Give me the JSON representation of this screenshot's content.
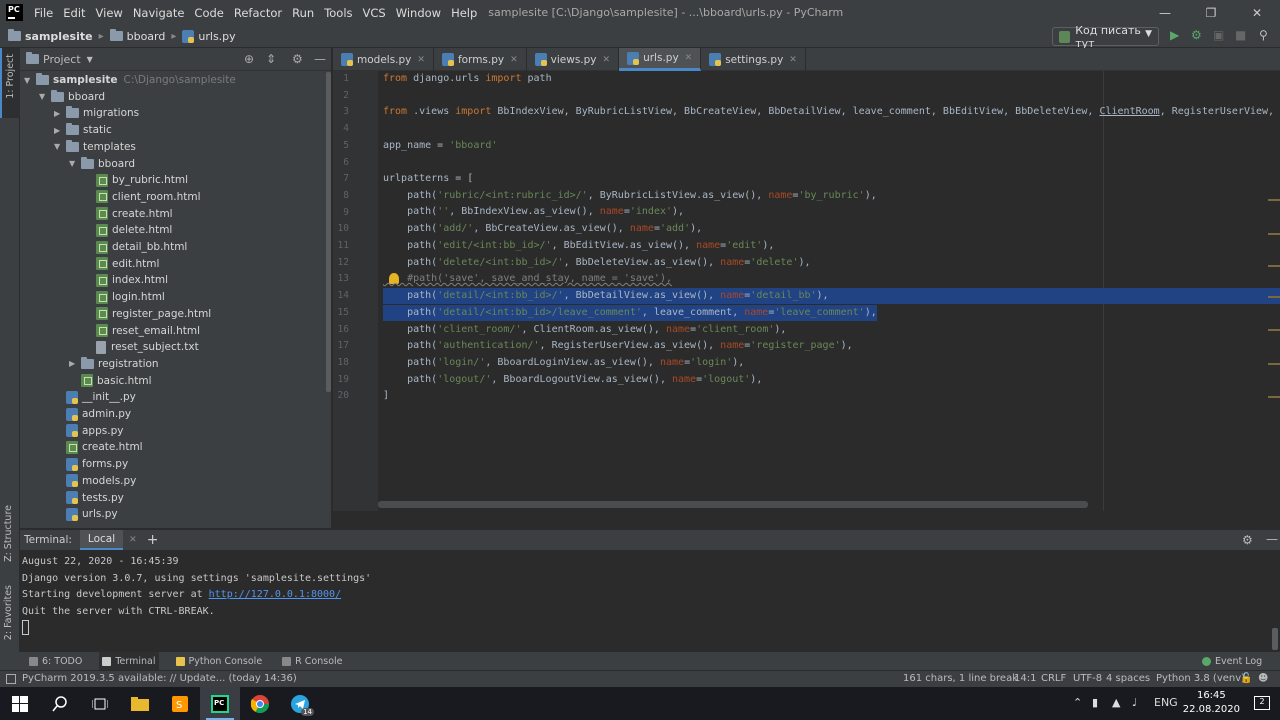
{
  "menubar": {
    "items": [
      "File",
      "Edit",
      "View",
      "Navigate",
      "Code",
      "Refactor",
      "Run",
      "Tools",
      "VCS",
      "Window",
      "Help"
    ],
    "title": "samplesite [C:\\Django\\samplesite] - ...\\bboard\\urls.py - PyCharm"
  },
  "navbar": {
    "crumbs": [
      "samplesite",
      "bboard",
      "urls.py"
    ],
    "run_config": "Код писать тут"
  },
  "project_panel": {
    "title": "Project",
    "tree": [
      {
        "label": "samplesite",
        "suffix": "C:\\Django\\samplesite",
        "depth": 0,
        "kind": "folder",
        "expanded": true,
        "bold": true
      },
      {
        "label": "bboard",
        "depth": 1,
        "kind": "folder",
        "expanded": true
      },
      {
        "label": "migrations",
        "depth": 2,
        "kind": "folder",
        "expanded": false
      },
      {
        "label": "static",
        "depth": 2,
        "kind": "folder",
        "expanded": false
      },
      {
        "label": "templates",
        "depth": 2,
        "kind": "folder",
        "expanded": true
      },
      {
        "label": "bboard",
        "depth": 3,
        "kind": "folder",
        "expanded": true
      },
      {
        "label": "by_rubric.html",
        "depth": 4,
        "kind": "html"
      },
      {
        "label": "client_room.html",
        "depth": 4,
        "kind": "html"
      },
      {
        "label": "create.html",
        "depth": 4,
        "kind": "html"
      },
      {
        "label": "delete.html",
        "depth": 4,
        "kind": "html"
      },
      {
        "label": "detail_bb.html",
        "depth": 4,
        "kind": "html"
      },
      {
        "label": "edit.html",
        "depth": 4,
        "kind": "html"
      },
      {
        "label": "index.html",
        "depth": 4,
        "kind": "html"
      },
      {
        "label": "login.html",
        "depth": 4,
        "kind": "html"
      },
      {
        "label": "register_page.html",
        "depth": 4,
        "kind": "html"
      },
      {
        "label": "reset_email.html",
        "depth": 4,
        "kind": "html"
      },
      {
        "label": "reset_subject.txt",
        "depth": 4,
        "kind": "txt"
      },
      {
        "label": "registration",
        "depth": 3,
        "kind": "folder",
        "expanded": false
      },
      {
        "label": "basic.html",
        "depth": 3,
        "kind": "html"
      },
      {
        "label": "__init__.py",
        "depth": 2,
        "kind": "py"
      },
      {
        "label": "admin.py",
        "depth": 2,
        "kind": "py"
      },
      {
        "label": "apps.py",
        "depth": 2,
        "kind": "py"
      },
      {
        "label": "create.html",
        "depth": 2,
        "kind": "html"
      },
      {
        "label": "forms.py",
        "depth": 2,
        "kind": "py"
      },
      {
        "label": "models.py",
        "depth": 2,
        "kind": "py"
      },
      {
        "label": "tests.py",
        "depth": 2,
        "kind": "py"
      },
      {
        "label": "urls.py",
        "depth": 2,
        "kind": "py"
      }
    ]
  },
  "editor_tabs": [
    {
      "label": "models.py",
      "active": false
    },
    {
      "label": "forms.py",
      "active": false
    },
    {
      "label": "views.py",
      "active": false
    },
    {
      "label": "urls.py",
      "active": true
    },
    {
      "label": "settings.py",
      "active": false
    }
  ],
  "code_lines": [
    "1",
    "2",
    "3",
    "4",
    "5",
    "6",
    "7",
    "8",
    "9",
    "10",
    "11",
    "12",
    "13",
    "14",
    "15",
    "16",
    "17",
    "18",
    "19",
    "20"
  ],
  "code": {
    "l1_a": "from",
    "l1_b": " django.urls ",
    "l1_c": "import",
    "l1_d": " path",
    "l3_a": "from",
    "l3_b": " .views ",
    "l3_c": "import",
    "l3_d": " BbIndexView, ByRubricListView, BbCreateView, BbDetailView, leave_comment, BbEditView, BbDeleteView, ",
    "l3_e": "ClientRoom",
    "l3_f": ", RegisterUserView, B",
    "l5_a": "app_name = ",
    "l5_b": "'bboard'",
    "l7": "urlpatterns = [",
    "l8_a": "    path(",
    "l8_b": "'rubric/<int:rubric_id>/'",
    "l8_c": ", ByRubricListView.as_view(), ",
    "l8_d": "name",
    "l8_e": "=",
    "l8_f": "'by_rubric'",
    "l8_g": "),",
    "l9_a": "    path(",
    "l9_b": "''",
    "l9_c": ", BbIndexView.as_view(), ",
    "l9_d": "name",
    "l9_e": "=",
    "l9_f": "'index'",
    "l9_g": "),",
    "l10_a": "    path(",
    "l10_b": "'add/'",
    "l10_c": ", BbCreateView.as_view(), ",
    "l10_d": "name",
    "l10_e": "=",
    "l10_f": "'add'",
    "l10_g": "),",
    "l11_a": "    path(",
    "l11_b": "'edit/<int:bb_id>/'",
    "l11_c": ", BbEditView.as_view(), ",
    "l11_d": "name",
    "l11_e": "=",
    "l11_f": "'edit'",
    "l11_g": "),",
    "l12_a": "    path(",
    "l12_b": "'delete/<int:bb_id>/'",
    "l12_c": ", BbDeleteView.as_view(), ",
    "l12_d": "name",
    "l12_e": "=",
    "l12_f": "'delete'",
    "l12_g": "),",
    "l13": "    #path('save', save_and_stay, name = 'save'),",
    "l14_a": "    path(",
    "l14_b": "'detail/<int:bb_id>/'",
    "l14_c": ", BbDetailView.as_view(), ",
    "l14_d": "name",
    "l14_e": "=",
    "l14_f": "'detail_bb'",
    "l14_g": "),",
    "l15_a": "    path(",
    "l15_b": "'detail/<int:bb_id>/leave_comment'",
    "l15_c": ", leave_comment, ",
    "l15_d": "name",
    "l15_e": "=",
    "l15_f": "'leave_comment'",
    "l15_g": "),",
    "l16_a": "    path(",
    "l16_b": "'client_room/'",
    "l16_c": ", ClientRoom.as_view(), ",
    "l16_d": "name",
    "l16_e": "=",
    "l16_f": "'client_room'",
    "l16_g": "),",
    "l17_a": "    path(",
    "l17_b": "'authentication/'",
    "l17_c": ", RegisterUserView.as_view(), ",
    "l17_d": "name",
    "l17_e": "=",
    "l17_f": "'register_page'",
    "l17_g": "),",
    "l18_a": "    path(",
    "l18_b": "'login/'",
    "l18_c": ", BboardLoginView.as_view(), ",
    "l18_d": "name",
    "l18_e": "=",
    "l18_f": "'login'",
    "l18_g": "),",
    "l19_a": "    path(",
    "l19_b": "'logout/'",
    "l19_c": ", BboardLogoutView.as_view(), ",
    "l19_d": "name",
    "l19_e": "=",
    "l19_f": "'logout'",
    "l19_g": "),",
    "l20": "]"
  },
  "terminal": {
    "label": "Terminal:",
    "tab": "Local",
    "plus": "+",
    "lines": [
      "August 22, 2020 - 16:45:39",
      "Django version 3.0.7, using settings 'samplesite.settings'",
      "Starting development server at "
    ],
    "link": "http://127.0.0.1:8000/",
    "last": "Quit the server with CTRL-BREAK."
  },
  "left_strip": {
    "project": "1: Project",
    "structure": "Z: Structure",
    "favorites": "2: Favorites"
  },
  "bottom_tools": [
    "6: TODO",
    "Terminal",
    "Python Console",
    "R Console"
  ],
  "event_log": "Event Log",
  "status": {
    "message": "PyCharm 2019.3.5 available: // Update... (today 14:36)",
    "chars": "161 chars, 1 line break",
    "pos": "14:1",
    "eol": "CRLF",
    "enc": "UTF-8",
    "indent": "4 spaces",
    "interp": "Python 3.8 (venv)"
  },
  "taskbar": {
    "lang": "ENG",
    "time": "16:45",
    "date": "22.08.2020",
    "telegram_badge": "14",
    "notif": "2"
  },
  "colors": {
    "accent": "#4a88c7",
    "selection": "#214283",
    "keyword": "#cc7832",
    "string": "#6a8759",
    "param": "#aa4926"
  }
}
